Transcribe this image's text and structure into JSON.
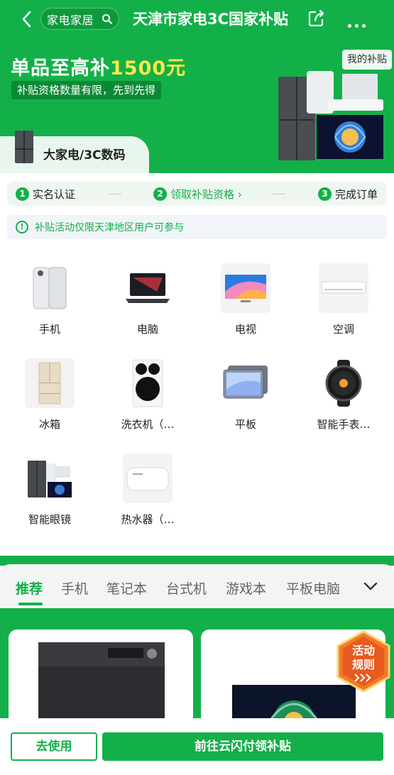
{
  "header": {
    "search_chip": "家电家居",
    "title": "天津市家电3C国家补贴"
  },
  "promo": {
    "headline_prefix": "单品至高补",
    "headline_amount": "1500元",
    "subline": "补贴资格数量有限，先到先得",
    "my_subsidy": "我的补贴"
  },
  "category_tab": {
    "label": "大家电/3C数码"
  },
  "steps": [
    {
      "num": "1",
      "label": "实名认证"
    },
    {
      "num": "2",
      "label": "领取补贴资格 ›"
    },
    {
      "num": "3",
      "label": "完成订单"
    }
  ],
  "notice": {
    "icon": "!",
    "text": "补贴活动仅限天津地区用户可参与"
  },
  "categories": [
    {
      "label": "手机"
    },
    {
      "label": "电脑"
    },
    {
      "label": "电视"
    },
    {
      "label": "空调"
    },
    {
      "label": "冰箱"
    },
    {
      "label": "洗衣机（…"
    },
    {
      "label": "平板"
    },
    {
      "label": "智能手表…"
    },
    {
      "label": "智能眼镜"
    },
    {
      "label": "热水器（…"
    }
  ],
  "product_tabs": [
    "推荐",
    "手机",
    "笔记本",
    "台式机",
    "游戏本",
    "平板电脑"
  ],
  "rules_badge": {
    "line1": "活动",
    "line2": "规则"
  },
  "actions": {
    "use": "去使用",
    "go": "前往云闪付领补贴"
  },
  "colors": {
    "brand_green": "#13b049",
    "accent_yellow": "#f7e94b",
    "badge_orange": "#f07a2a"
  }
}
